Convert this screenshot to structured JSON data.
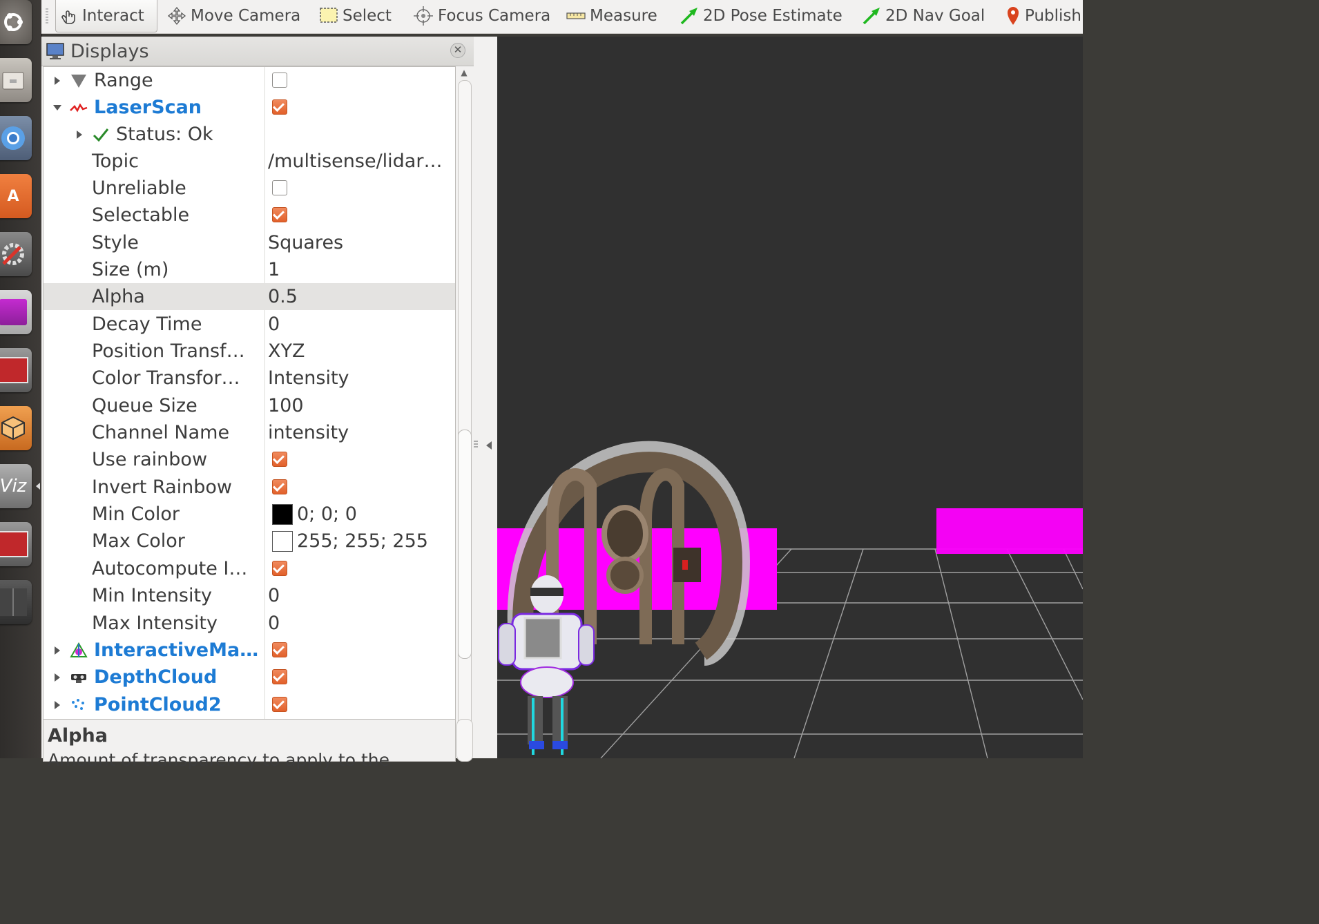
{
  "toolbar": {
    "tools": [
      {
        "label": "Interact",
        "icon": "hand-pointer-icon"
      },
      {
        "label": "Move Camera",
        "icon": "move-camera-icon"
      },
      {
        "label": "Select",
        "icon": "select-box-icon"
      },
      {
        "label": "Focus Camera",
        "icon": "focus-camera-icon"
      },
      {
        "label": "Measure",
        "icon": "ruler-icon"
      },
      {
        "label": "2D Pose Estimate",
        "icon": "green-arrow-icon"
      },
      {
        "label": "2D Nav Goal",
        "icon": "green-arrow-icon"
      },
      {
        "label": "Publish",
        "icon": "map-pin-icon"
      }
    ]
  },
  "launcher": {
    "items": [
      "ubuntu-dash-icon",
      "files-icon",
      "chromium-icon",
      "software-center-icon",
      "system-settings-icon",
      "purple-app-icon",
      "terminal-icon",
      "virtualbox-icon",
      "rviz-icon",
      "terminal-icon",
      "workspace-switcher-icon"
    ],
    "rviz_label": "Viz"
  },
  "displays": {
    "title": "Displays",
    "rows": [
      {
        "name": "Range",
        "check": false
      },
      {
        "name": "LaserScan",
        "check": true
      },
      {
        "name": "Status: Ok"
      },
      {
        "name": "Topic",
        "value": "/multisense/lidar…"
      },
      {
        "name": "Unreliable",
        "check": false
      },
      {
        "name": "Selectable",
        "check": true
      },
      {
        "name": "Style",
        "value": "Squares"
      },
      {
        "name": "Size (m)",
        "value": "1"
      },
      {
        "name": "Alpha",
        "value": "0.5"
      },
      {
        "name": "Decay Time",
        "value": "0"
      },
      {
        "name": "Position Transf…",
        "value": "XYZ"
      },
      {
        "name": "Color Transfor…",
        "value": "Intensity"
      },
      {
        "name": "Queue Size",
        "value": "100"
      },
      {
        "name": "Channel Name",
        "value": "intensity"
      },
      {
        "name": "Use rainbow",
        "check": true
      },
      {
        "name": "Invert Rainbow",
        "check": true
      },
      {
        "name": "Min Color",
        "value": "0; 0; 0",
        "color": "#000000"
      },
      {
        "name": "Max Color",
        "value": "255; 255; 255",
        "color": "#ffffff"
      },
      {
        "name": "Autocompute I…",
        "check": true
      },
      {
        "name": "Min Intensity",
        "value": "0"
      },
      {
        "name": "Max Intensity",
        "value": "0"
      },
      {
        "name": "InteractiveMa…",
        "check": true
      },
      {
        "name": "DepthCloud",
        "check": true
      },
      {
        "name": "PointCloud2",
        "check": true
      }
    ]
  },
  "help": {
    "title": "Alpha",
    "text": "Amount of transparency to apply to the"
  },
  "colors": {
    "plugin_blue": "#1d7bd4",
    "check_orange": "#e2612b",
    "view_background": "#303030",
    "wall_magenta": "#ff00ff",
    "grid_line": "#a0a0a0"
  }
}
